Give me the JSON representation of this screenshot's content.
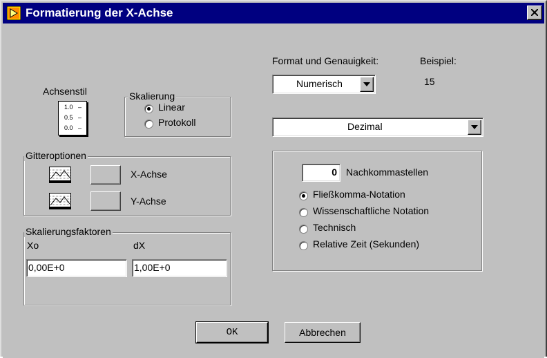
{
  "window": {
    "title": "Formatierung der X-Achse"
  },
  "axis_style": {
    "label": "Achsenstil",
    "ticks": [
      "1.0",
      "0.5",
      "0.0"
    ]
  },
  "scaling": {
    "label": "Skalierung",
    "options": [
      {
        "label": "Linear",
        "checked": true
      },
      {
        "label": "Protokoll",
        "checked": false
      }
    ]
  },
  "grid_options": {
    "label": "Gitteroptionen",
    "rows": [
      {
        "label": "X-Achse",
        "icon": "grid-icon"
      },
      {
        "label": "Y-Achse",
        "icon": "grid-icon"
      }
    ]
  },
  "scale_factors": {
    "label": "Skalierungsfaktoren",
    "x0_label": "Xo",
    "dx_label": "dX",
    "x0_value": "0,00E+0",
    "dx_value": "1,00E+0"
  },
  "format": {
    "label": "Format und Genauigkeit:",
    "type_value": "Numerisch",
    "example_label": "Beispiel:",
    "example_value": "15",
    "base_value": "Dezimal"
  },
  "precision": {
    "digits_value": "0",
    "digits_label": "Nachkommastellen",
    "notations": [
      {
        "label": "Fließkomma-Notation",
        "checked": true
      },
      {
        "label": "Wissenschaftliche Notation",
        "checked": false
      },
      {
        "label": "Technisch",
        "checked": false
      },
      {
        "label": "Relative Zeit (Sekunden)",
        "checked": false
      }
    ]
  },
  "buttons": {
    "ok": "OK",
    "cancel": "Abbrechen"
  },
  "colors": {
    "face": "#c0c0c0",
    "titlebar": "#000080"
  }
}
